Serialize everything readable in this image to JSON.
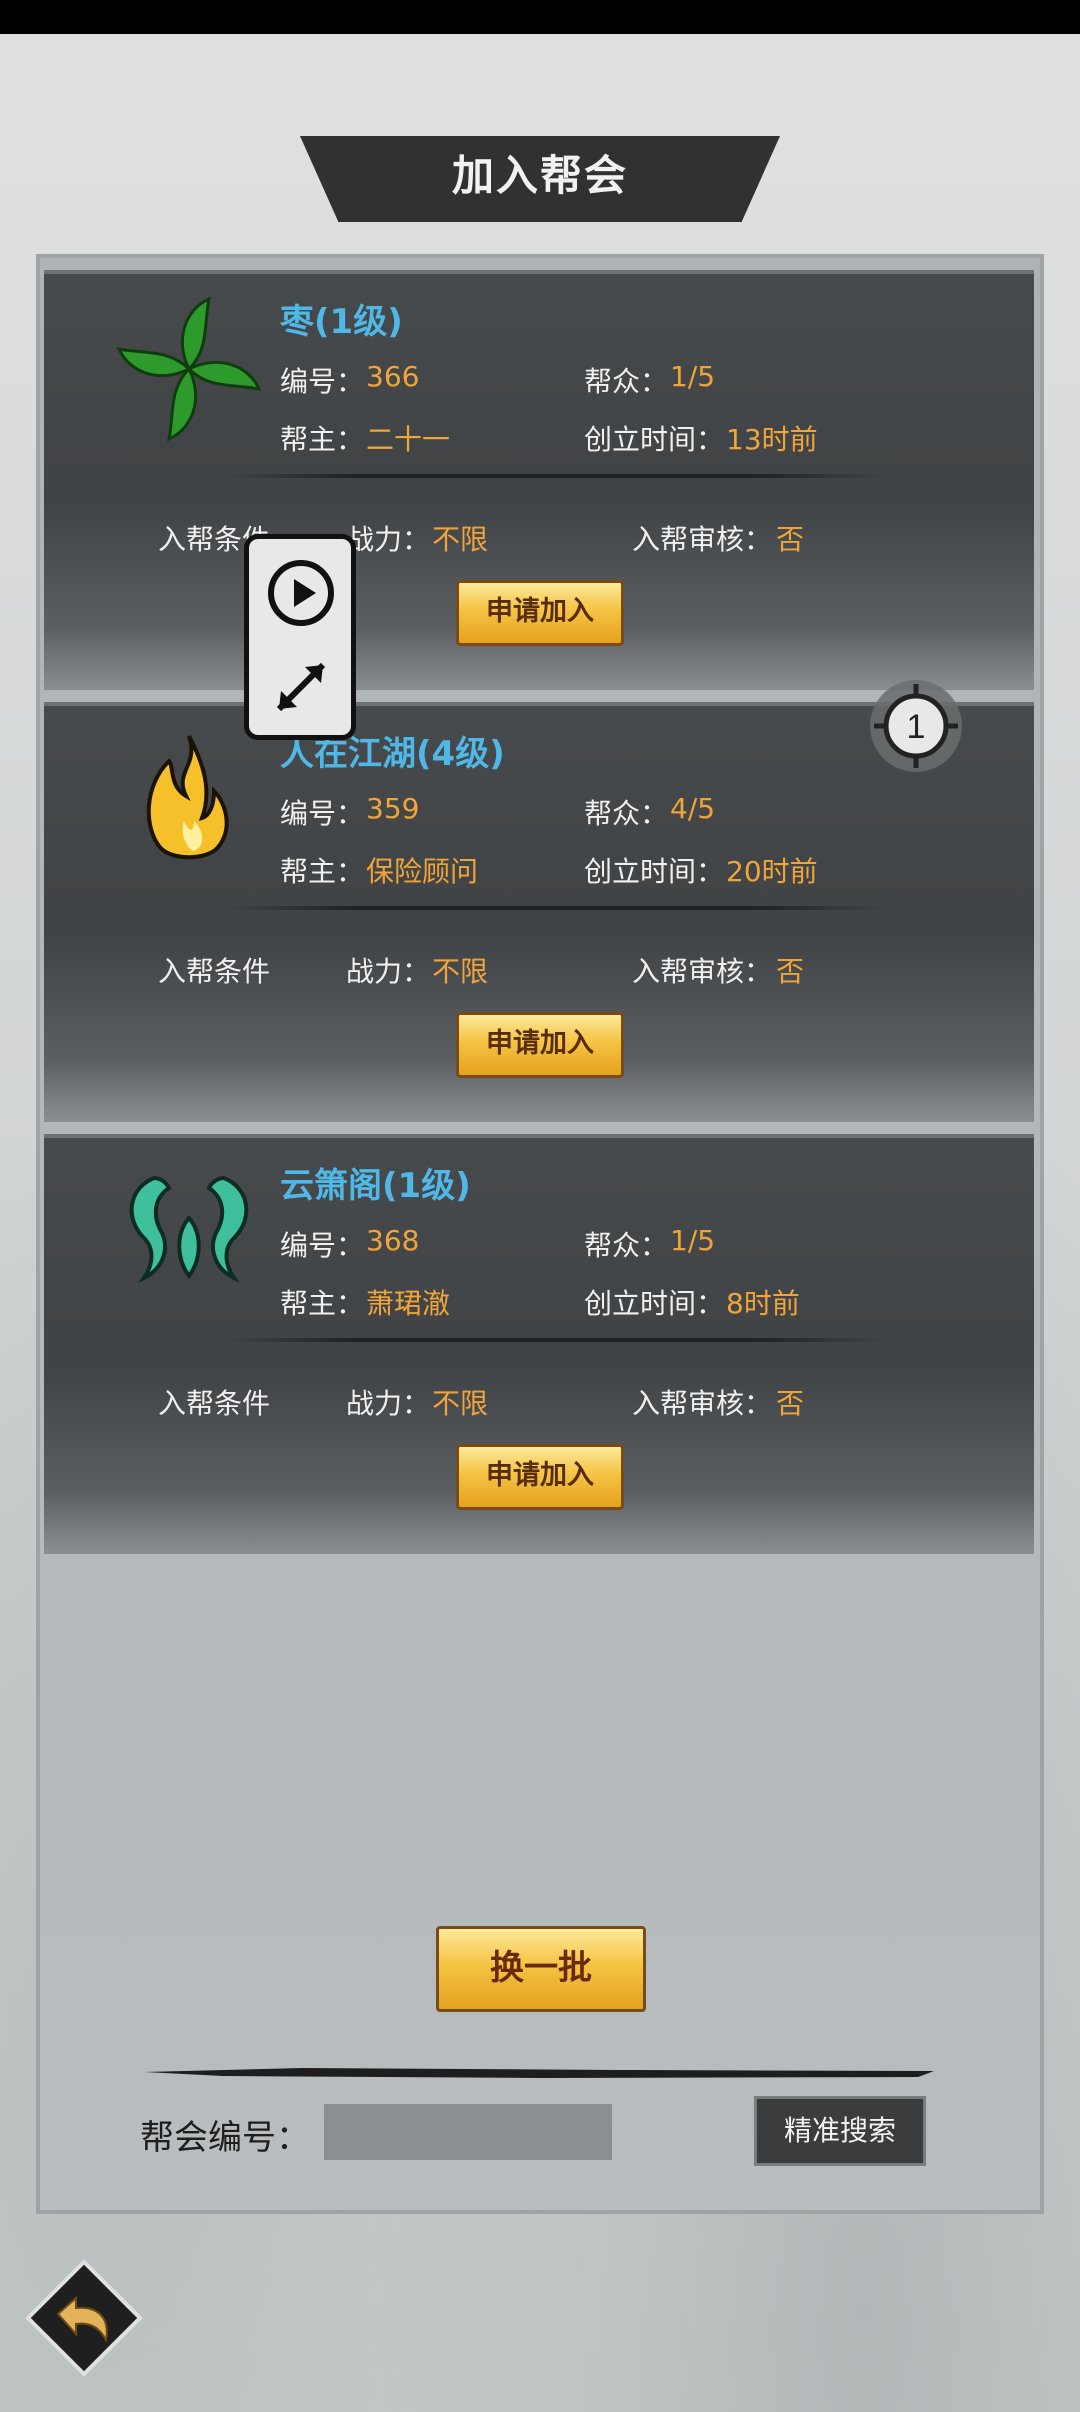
{
  "header": {
    "title": "加入帮会"
  },
  "labels": {
    "id": "编号：",
    "members": "帮众：",
    "leader": "帮主：",
    "created": "创立时间：",
    "conditions": "入帮条件",
    "power": "战力：",
    "review": "入帮审核："
  },
  "guilds": [
    {
      "name": "枣(1级)",
      "id": "366",
      "members": "1/5",
      "leader": "二十一",
      "created": "13时前",
      "power": "不限",
      "review": "否",
      "apply_label": "申请加入",
      "emblem": "clover-emblem-icon",
      "emblem_color": "#2e9a2c"
    },
    {
      "name": "人在江湖(4级)",
      "id": "359",
      "members": "4/5",
      "leader": "保险顾问",
      "created": "20时前",
      "power": "不限",
      "review": "否",
      "apply_label": "申请加入",
      "emblem": "flame-emblem-icon",
      "emblem_color": "#f5c02a"
    },
    {
      "name": "云箫阁(1级)",
      "id": "368",
      "members": "1/5",
      "leader": "萧珺澈",
      "created": "8时前",
      "power": "不限",
      "review": "否",
      "apply_label": "申请加入",
      "emblem": "swirl-emblem-icon",
      "emblem_color": "#3fbf9b"
    }
  ],
  "actions": {
    "refresh_label": "换一批"
  },
  "search": {
    "label": "帮会编号：",
    "value": "",
    "placeholder": "",
    "button_label": "精准搜索"
  },
  "overlay": {
    "badge": "1"
  },
  "colors": {
    "accent_gold": "#f0a43a",
    "name_blue": "#4fb8e6"
  }
}
